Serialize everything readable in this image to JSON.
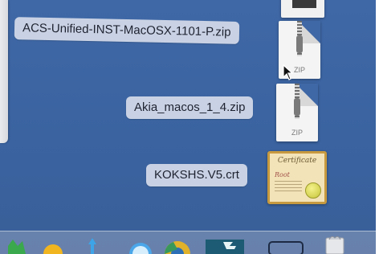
{
  "desktop": {
    "files": [
      {
        "name": "ACS-Unified-INST-MacOSX-1101-P.zip",
        "type": "zip",
        "icon_text": "ZIP"
      },
      {
        "name": "Akia_macos_1_4.zip",
        "type": "zip",
        "icon_text": "ZIP"
      },
      {
        "name": "KOKSHS.V5.crt",
        "type": "certificate",
        "icon_title": "Certificate",
        "icon_subtitle": "Root"
      }
    ]
  },
  "dock": {
    "items": [
      {
        "name": "finder-icon"
      },
      {
        "name": "launchpad-icon"
      },
      {
        "name": "safari-icon"
      },
      {
        "name": "chrome-icon"
      },
      {
        "name": "app-icon"
      },
      {
        "name": "folder-icon"
      },
      {
        "name": "trash-icon"
      }
    ]
  },
  "colors": {
    "desktop_bg": "#3f68a6",
    "label_bg": "#c9d2e4",
    "label_text": "#1e2230"
  }
}
